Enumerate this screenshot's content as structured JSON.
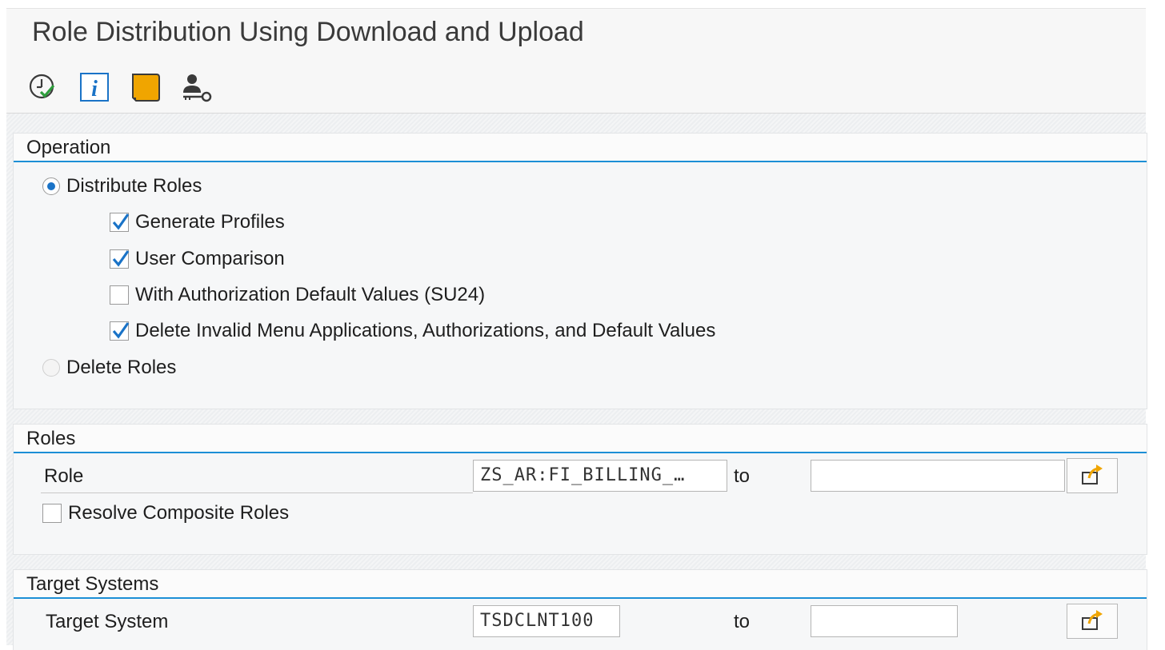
{
  "window": {
    "title": "Role Distribution Using Download and Upload"
  },
  "toolbar": {
    "icons": [
      "execute-icon",
      "info-icon",
      "variant-icon",
      "user-key-icon"
    ]
  },
  "operation": {
    "heading": "Operation",
    "distribute_roles": {
      "label": "Distribute Roles",
      "selected": true
    },
    "generate_profiles": {
      "label": "Generate Profiles",
      "checked": true
    },
    "user_comparison": {
      "label": "User Comparison",
      "checked": true
    },
    "auth_default_values": {
      "label": "With Authorization Default Values (SU24)",
      "checked": false
    },
    "delete_invalid": {
      "label": "Delete Invalid Menu Applications, Authorizations, and Default Values",
      "checked": true
    },
    "delete_roles": {
      "label": "Delete Roles",
      "selected": false
    }
  },
  "roles": {
    "heading": "Roles",
    "role_label": "Role",
    "role_from": "ZS_AR:FI_BILLING_…",
    "to_label": "to",
    "role_to": "",
    "resolve_composite": {
      "label": "Resolve Composite Roles",
      "checked": false
    }
  },
  "target_systems": {
    "heading": "Target Systems",
    "target_label": "Target System",
    "target_from": "TSDCLNT100",
    "to_label": "to",
    "target_to": ""
  },
  "colors": {
    "accent": "#1c8fd6",
    "check": "#1a73c7",
    "variant_folder": "#f0a500"
  }
}
